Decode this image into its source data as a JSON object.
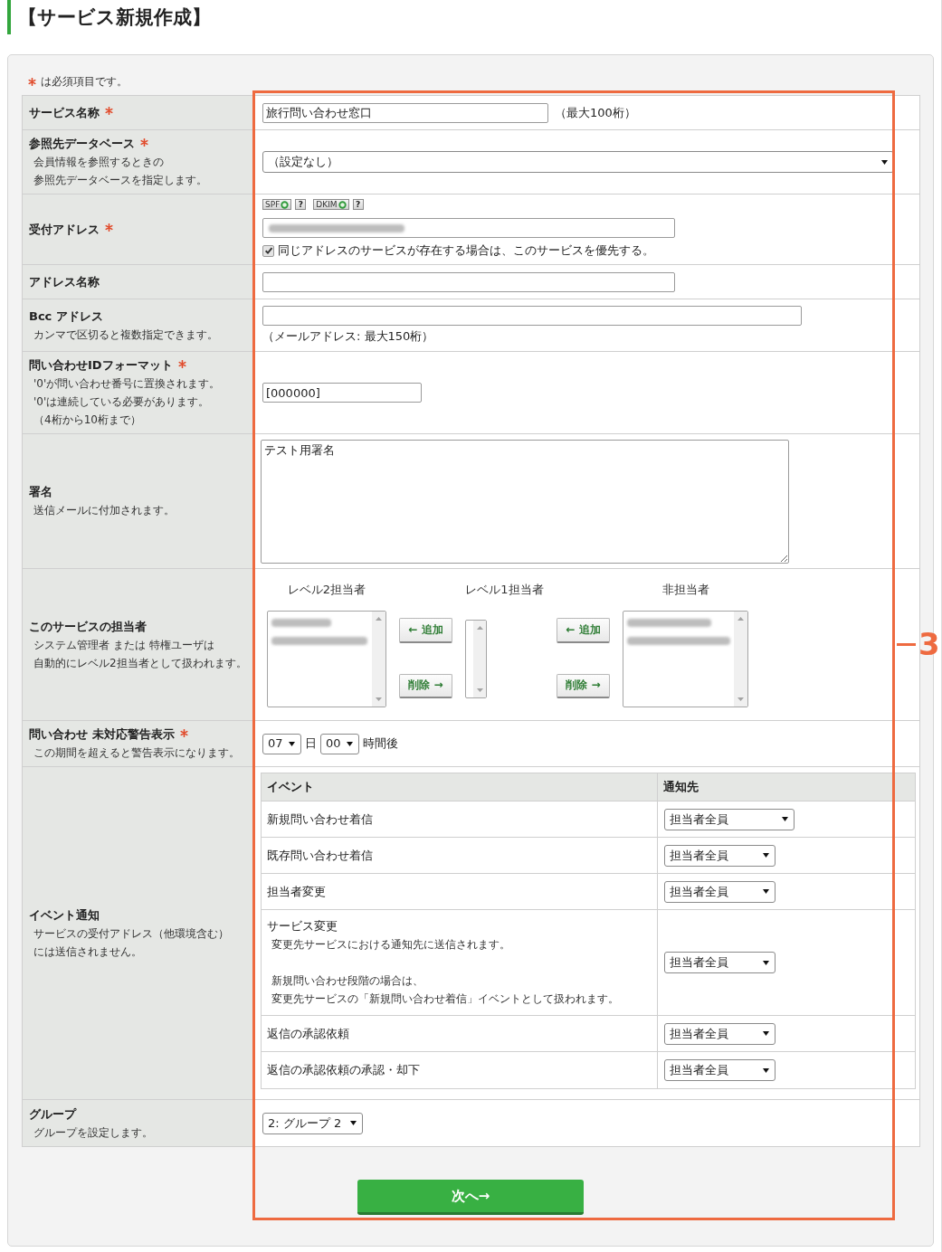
{
  "header": {
    "title": "【サービス新規作成】"
  },
  "legend": {
    "text": "は必須項目です。"
  },
  "form": {
    "rows": [
      {
        "label": "サービス名称",
        "required": true,
        "kind": "text",
        "value": "旅行問い合わせ窓口",
        "suffix": "（最大100桁）"
      },
      {
        "label": "参照先データベース",
        "required": true,
        "notes": [
          "会員情報を参照するときの",
          "参照先データベースを指定します。"
        ],
        "kind": "select",
        "value": "（設定なし）"
      },
      {
        "label": "受付アドレス",
        "required": true,
        "kind": "address",
        "badges": [
          {
            "label": "SPF",
            "verified": true,
            "help": "?"
          },
          {
            "label": "DKIM",
            "verified": true,
            "help": "?"
          }
        ],
        "redacted": true,
        "checkbox": {
          "label": "同じアドレスのサービスが存在する場合は、このサービスを優先する。",
          "checked": true
        }
      },
      {
        "label": "アドレス名称",
        "required": false,
        "kind": "text"
      },
      {
        "label": "Bcc アドレス",
        "required": false,
        "notes": [
          "カンマで区切ると複数指定できます。"
        ],
        "kind": "text",
        "hint": "（メールアドレス: 最大150桁）"
      },
      {
        "label": "問い合わせIDフォーマット",
        "required": true,
        "notes": [
          "'0'が問い合わせ番号に置換されます。",
          "'0'は連続している必要があります。",
          "（4桁から10桁まで）"
        ],
        "kind": "text",
        "value": "[000000]"
      },
      {
        "label": "署名",
        "required": false,
        "notes": [
          "送信メールに付加されます。"
        ],
        "kind": "textarea",
        "value": "テスト用署名"
      },
      {
        "label": "このサービスの担当者",
        "required": false,
        "notes": [
          "システム管理者 または 特権ユーザは",
          "自動的にレベル2担当者として扱われます。"
        ],
        "kind": "assignees",
        "columns": [
          {
            "kind": "list",
            "heading": "レベル2担当者",
            "entries": [
              {
                "kind": "name"
              },
              {
                "kind": "email"
              }
            ]
          },
          {
            "kind": "movers",
            "add": "← 追加",
            "remove": "削除 →"
          },
          {
            "kind": "list",
            "heading": "レベル1担当者"
          },
          {
            "kind": "movers",
            "add": "← 追加",
            "remove": "削除 →"
          },
          {
            "kind": "list",
            "heading": "非担当者",
            "entries": [
              {
                "kind": "name"
              },
              {
                "kind": "email"
              }
            ]
          }
        ]
      },
      {
        "label": "問い合わせ 未対応警告表示",
        "required": true,
        "notes": [
          "この期間を超えると警告表示になります。"
        ],
        "kind": "duration",
        "parts": [
          {
            "kind": "select",
            "value": "07"
          },
          {
            "kind": "text",
            "text": "日"
          },
          {
            "kind": "select",
            "value": "00"
          },
          {
            "kind": "text",
            "text": "時間後"
          }
        ]
      },
      {
        "label": "イベント通知",
        "required": false,
        "notes": [
          "サービスの受付アドレス（他環境含む）",
          "には送信されません。"
        ],
        "kind": "events",
        "table": {
          "columns": [
            "イベント",
            "通知先"
          ],
          "rows": [
            {
              "event": "新規問い合わせ着信",
              "notify": "担当者全員"
            },
            {
              "event": "既存問い合わせ着信",
              "notify": "担当者全員"
            },
            {
              "event": "担当者変更",
              "notify": "担当者全員"
            },
            {
              "event": "サービス変更",
              "notes": [
                [
                  "変更先サービスにおける通知先に送信されます。"
                ],
                [
                  "新規問い合わせ段階の場合は、",
                  "変更先サービスの「新規問い合わせ着信」イベントとして扱われます。"
                ]
              ],
              "notify": "担当者全員"
            },
            {
              "event": "返信の承認依頼",
              "notify": "担当者全員"
            },
            {
              "event": "返信の承認依頼の承認・却下",
              "notify": "担当者全員"
            }
          ]
        }
      },
      {
        "label": "グループ",
        "required": false,
        "notes": [
          "グループを設定します。"
        ],
        "kind": "select",
        "value": "2: グループ 2"
      }
    ]
  },
  "submit_button": {
    "label": "次へ→"
  },
  "callout": {
    "label": "3"
  }
}
